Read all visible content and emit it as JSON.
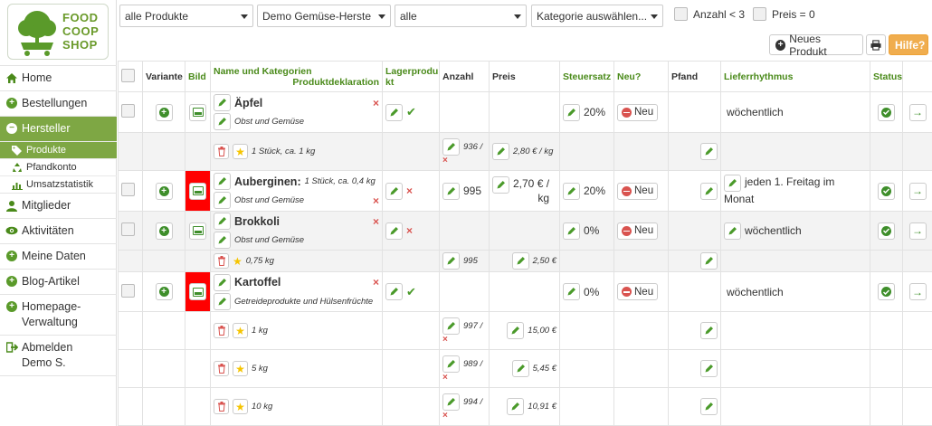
{
  "logo": {
    "line1": "FOOD",
    "line2": "COOP",
    "line3": "SHOP"
  },
  "sidebar": {
    "items": [
      {
        "label": "Home"
      },
      {
        "label": "Bestellungen"
      },
      {
        "label": "Hersteller"
      },
      {
        "label": "Mitglieder"
      },
      {
        "label": "Aktivitäten"
      },
      {
        "label": "Meine Daten"
      },
      {
        "label": "Blog-Artikel"
      },
      {
        "label": "Homepage-Verwaltung",
        "line1": "Homepage-",
        "line2": "Verwaltung"
      },
      {
        "label": "Abmelden Demo S.",
        "line1": "Abmelden",
        "line2": "Demo S."
      }
    ],
    "subitems": [
      {
        "label": "Produkte"
      },
      {
        "label": "Pfandkonto"
      },
      {
        "label": "Umsatzstatistik"
      }
    ]
  },
  "filters": {
    "products": "alle Produkte",
    "manufacturer": "Demo Gemüse-Herste",
    "status": "alle",
    "category": "Kategorie auswählen...",
    "amount_lt3": "Anzahl < 3",
    "price_zero": "Preis = 0"
  },
  "toolbar": {
    "new_product": "Neues Produkt",
    "help": "Hilfe?"
  },
  "table": {
    "headers": {
      "variant": "Variante",
      "image": "Bild",
      "name": "Name und Kategorien",
      "declaration": "Produktdeklaration",
      "stock1": "Lagerprodu",
      "stock2": "kt",
      "amount": "Anzahl",
      "price": "Preis",
      "tax": "Steuersatz",
      "new": "Neu?",
      "deposit": "Pfand",
      "rhythm": "Lieferrhythmus",
      "status": "Status"
    },
    "products": [
      {
        "name": "Äpfel",
        "unit": "",
        "category": "Obst und Gemüse",
        "amount": "",
        "price": "",
        "tax": "20%",
        "new": "Neu",
        "rhythm": "wöchentlich",
        "stock": true
      },
      {
        "name": "Auberginen:",
        "unit": "1 Stück,  ca. 0,4 kg",
        "category": "Obst und Gemüse",
        "amount": "995",
        "price_line1": "2,70 € /",
        "price_line2": "kg",
        "tax": "20%",
        "new": "Neu",
        "rhythm_line1": "jeden 1. Freitag im",
        "rhythm_line2": "Monat",
        "stock": false
      },
      {
        "name": "Brokkoli",
        "unit": "",
        "category": "Obst und Gemüse",
        "amount": "",
        "price": "",
        "tax": "0%",
        "new": "Neu",
        "rhythm": "wöchentlich",
        "stock": false
      },
      {
        "name": "Kartoffel",
        "unit": "",
        "category": "Getreideprodukte und Hülsenfrüchte",
        "amount": "",
        "price": "",
        "tax": "0%",
        "new": "Neu",
        "rhythm": "wöchentlich",
        "stock": true
      }
    ],
    "variants": [
      {
        "label": "1 Stück, ca. 1 kg",
        "amount": "936 /",
        "price": "2,80 € / kg"
      },
      {
        "label": "0,75 kg",
        "amount": "995",
        "price": "2,50 €"
      },
      {
        "label": "1 kg",
        "amount": "997 /",
        "price": "15,00 €"
      },
      {
        "label": "5 kg",
        "amount": "989 /",
        "price": "5,45 €"
      },
      {
        "label": "10 kg",
        "amount": "994 /",
        "price": "10,91 €"
      }
    ],
    "x_mark": "×"
  },
  "colors": {
    "accent": "#7ea744",
    "red": "#ff0000",
    "help": "#f0ad4e"
  }
}
